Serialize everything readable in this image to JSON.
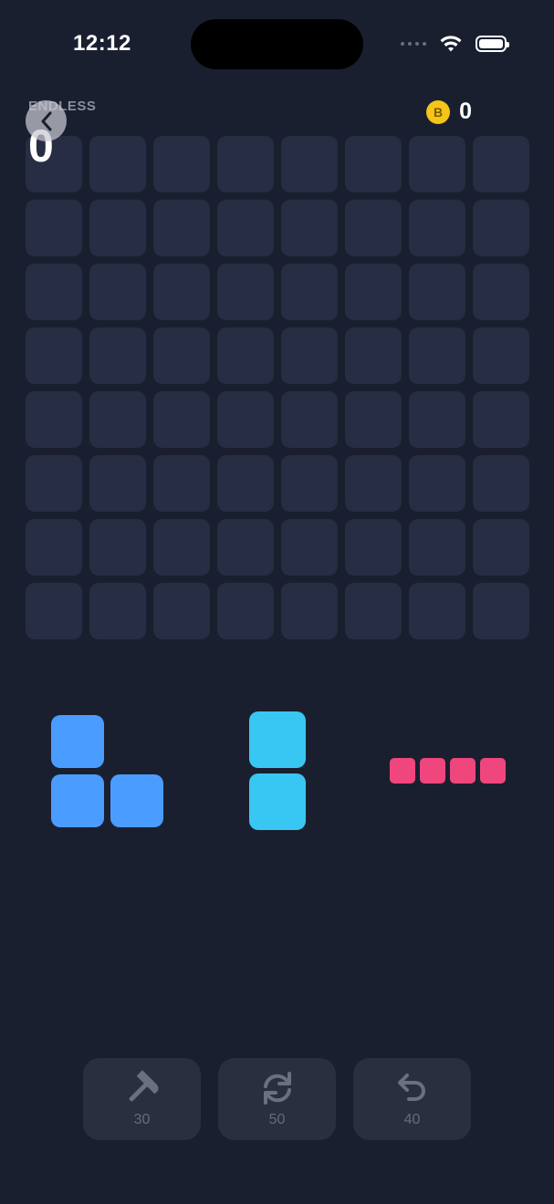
{
  "status_bar": {
    "time": "12:12"
  },
  "header": {
    "mode_label": "ENDLESS",
    "score": "0",
    "coins": "0",
    "coin_symbol": "B"
  },
  "board": {
    "rows": 8,
    "cols": 8
  },
  "pieces": [
    {
      "name": "L-tromino",
      "color": "#4b9cff"
    },
    {
      "name": "vertical-domino",
      "color": "#38c7f2"
    },
    {
      "name": "horizontal-i4",
      "color": "#f0467e"
    }
  ],
  "powerups": [
    {
      "icon": "hammer-icon",
      "count": "30"
    },
    {
      "icon": "refresh-icon",
      "count": "50"
    },
    {
      "icon": "undo-icon",
      "count": "40"
    }
  ],
  "colors": {
    "background": "#1a1f30",
    "cell": "#272d42",
    "coin": "#f5c518"
  }
}
